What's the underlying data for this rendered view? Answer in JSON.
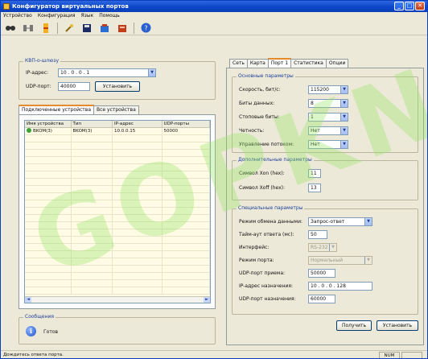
{
  "window": {
    "title": "Конфигуратор виртуальных портов"
  },
  "menu": [
    "Устройство",
    "Конфигурация",
    "Язык",
    "Помощь"
  ],
  "toolbar": {
    "icons": [
      "find-icon",
      "connect-icon",
      "add-icon",
      "plugin-icon",
      "save-icon",
      "open-icon",
      "close-file-icon",
      "help-icon"
    ]
  },
  "left": {
    "group_title": "КВП-о-шлюзу",
    "ip_label": "IP-адрес:",
    "ip_value": "10 . 0 . 0 . 1",
    "udp_label": "UDP-порт:",
    "udp_value": "40000",
    "set_button": "Установить",
    "tabs": [
      "Подключенные устройства",
      "Все устройства"
    ],
    "columns": [
      "Имя устройства",
      "Тип",
      "IP-адрес",
      "UDP-порты"
    ],
    "rows": [
      [
        "BKOM(3)",
        "BKOM(3)",
        "10.0.0.15",
        "50000"
      ]
    ],
    "messages_title": "Сообщения",
    "message_text": "Готов"
  },
  "right": {
    "tabs": [
      "Сеть",
      "Карта",
      "Порт 1",
      "Статистика",
      "Опции"
    ],
    "active_tab": "Порт 1",
    "basic": {
      "title": "Основные параметры",
      "speed_label": "Скорость, бит/с:",
      "speed_value": "115200",
      "databits_label": "Биты данных:",
      "databits_value": "8",
      "stopbits_label": "Стоповые биты:",
      "stopbits_value": "1",
      "parity_label": "Четность:",
      "parity_value": "Нет",
      "flow_label": "Управление потоком:",
      "flow_value": "Нет"
    },
    "extra": {
      "title": "Дополнительные параметры",
      "xon_label": "Символ Xon (hex):",
      "xon_value": "11",
      "xoff_label": "Символ Xoff (hex):",
      "xoff_value": "13"
    },
    "special": {
      "title": "Специальные параметры",
      "mode_label": "Режим обмена данными:",
      "mode_value": "Запрос-ответ",
      "timeout_label": "Тайм-аут ответа (мс):",
      "timeout_value": "50",
      "interface_label": "Интерфейс:",
      "interface_value": "RS-232",
      "portmode_label": "Режим порта:",
      "portmode_value": "Нормальный",
      "udp_rx_label": "UDP-порт приема:",
      "udp_rx_value": "50000",
      "dest_ip_label": "IP-адрес назначения:",
      "dest_ip_value": "10 . 0 . 0 . 128",
      "dest_udp_label": "UDP-порт назначения:",
      "dest_udp_value": "60000"
    },
    "get_button": "Получить",
    "set_button": "Установить"
  },
  "status": {
    "text": "Дождитесь ответа порта.",
    "num": "NUM"
  },
  "watermark": "GOPKNA"
}
